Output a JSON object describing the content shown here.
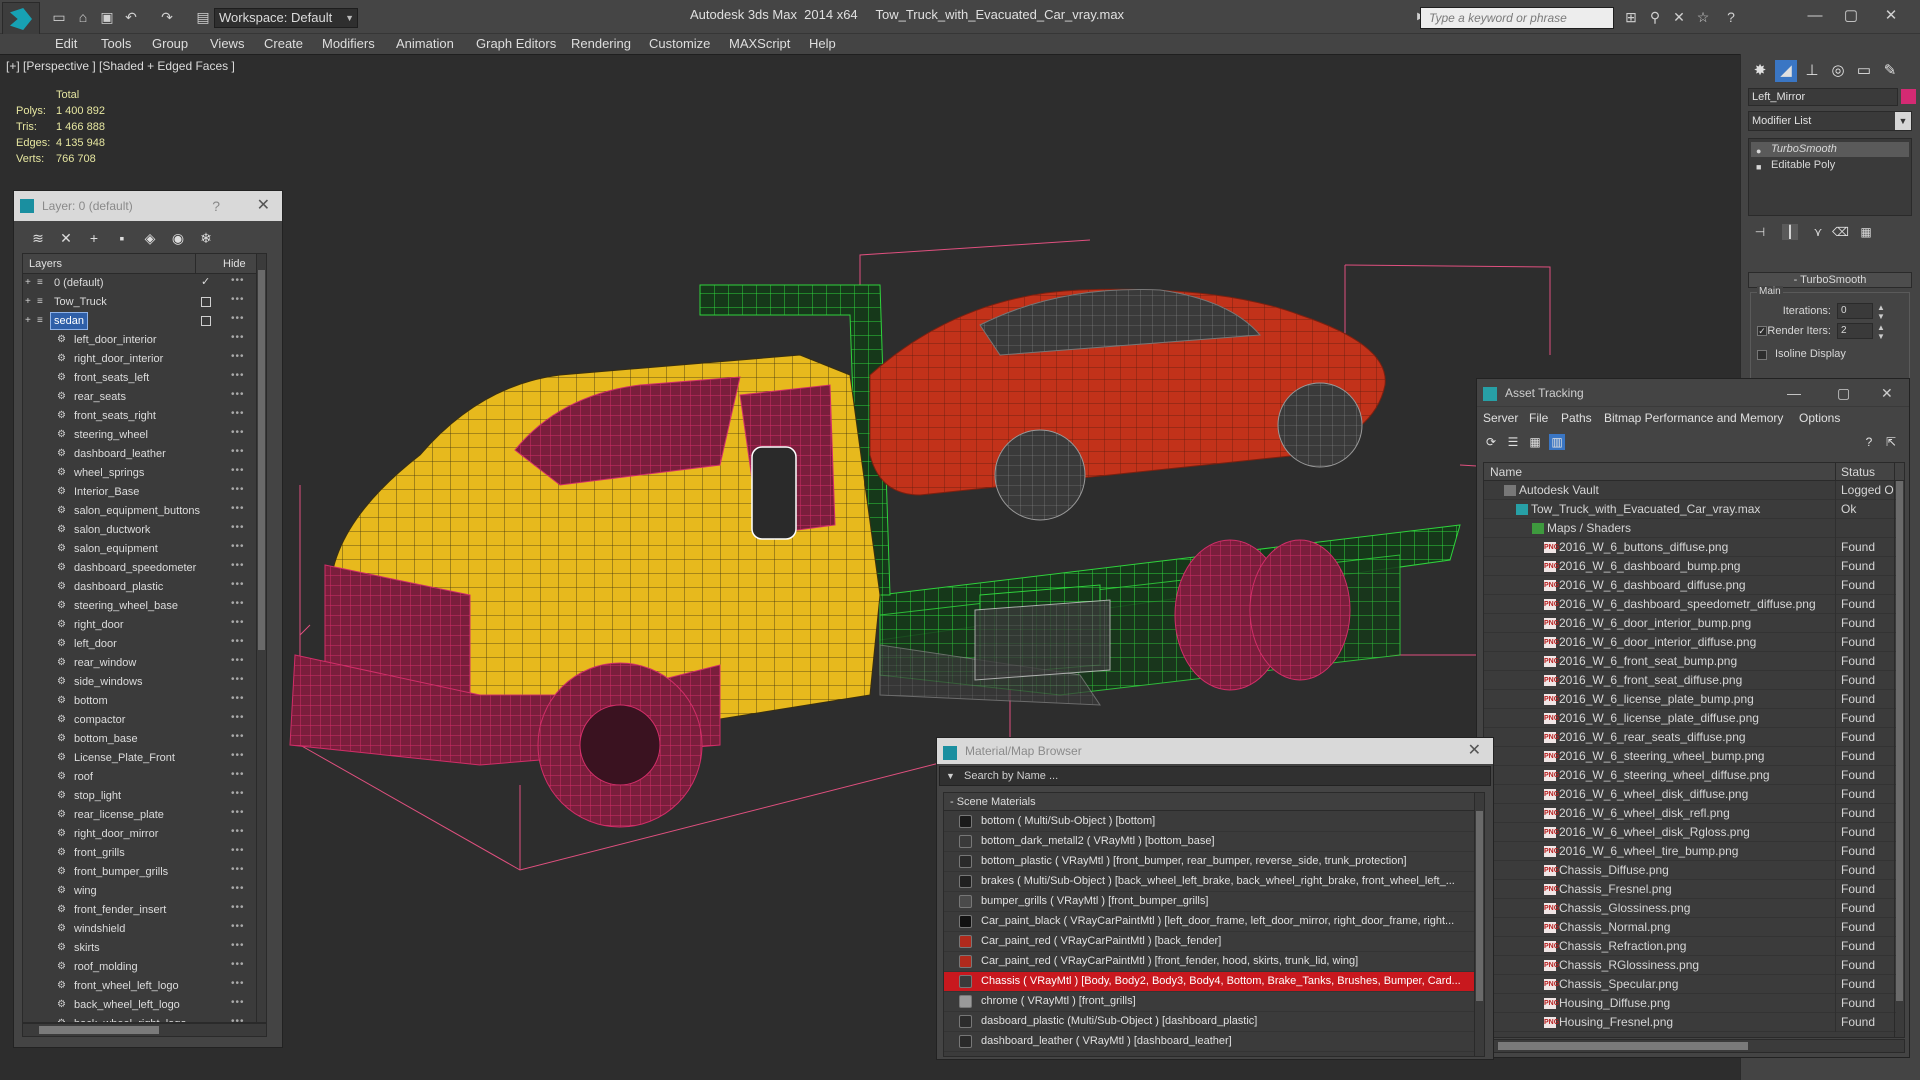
{
  "window": {
    "app_title": "Autodesk 3ds Max  2014 x64",
    "file_title": "Tow_Truck_with_Evacuated_Car_vray.max",
    "workspace": "Workspace: Default",
    "help_search_placeholder": "Type a keyword or phrase"
  },
  "menu": [
    "Edit",
    "Tools",
    "Group",
    "Views",
    "Create",
    "Modifiers",
    "Animation",
    "Graph Editors",
    "Rendering",
    "Customize",
    "MAXScript",
    "Help"
  ],
  "viewport": {
    "label": "[+] [Perspective ] [Shaded + Edged Faces ]",
    "stats": {
      "header": "Total",
      "rows": [
        {
          "key": "Polys:",
          "value": "1 400 892"
        },
        {
          "key": "Tris:",
          "value": "1 466 888"
        },
        {
          "key": "Edges:",
          "value": "4 135 948"
        },
        {
          "key": "Verts:",
          "value": "766 708"
        }
      ]
    }
  },
  "layer_panel": {
    "title": "Layer: 0 (default)",
    "help": "?",
    "close": "✕",
    "col_layers": "Layers",
    "col_hide": "Hide",
    "rows": [
      {
        "name": "0 (default)",
        "level": 0,
        "state": "check"
      },
      {
        "name": "Tow_Truck",
        "level": 0,
        "state": "box"
      },
      {
        "name": "sedan",
        "level": 0,
        "state": "box",
        "selected": true
      },
      {
        "name": "left_door_interior",
        "level": 1
      },
      {
        "name": "right_door_interior",
        "level": 1
      },
      {
        "name": "front_seats_left",
        "level": 1
      },
      {
        "name": "rear_seats",
        "level": 1
      },
      {
        "name": "front_seats_right",
        "level": 1
      },
      {
        "name": "steering_wheel",
        "level": 1
      },
      {
        "name": "dashboard_leather",
        "level": 1
      },
      {
        "name": "wheel_springs",
        "level": 1
      },
      {
        "name": "Interior_Base",
        "level": 1
      },
      {
        "name": "salon_equipment_buttons",
        "level": 1
      },
      {
        "name": "salon_ductwork",
        "level": 1
      },
      {
        "name": "salon_equipment",
        "level": 1
      },
      {
        "name": "dashboard_speedometer",
        "level": 1
      },
      {
        "name": "dashboard_plastic",
        "level": 1
      },
      {
        "name": "steering_wheel_base",
        "level": 1
      },
      {
        "name": "right_door",
        "level": 1
      },
      {
        "name": "left_door",
        "level": 1
      },
      {
        "name": "rear_window",
        "level": 1
      },
      {
        "name": "side_windows",
        "level": 1
      },
      {
        "name": "bottom",
        "level": 1
      },
      {
        "name": "compactor",
        "level": 1
      },
      {
        "name": "bottom_base",
        "level": 1
      },
      {
        "name": "License_Plate_Front",
        "level": 1
      },
      {
        "name": "roof",
        "level": 1
      },
      {
        "name": "stop_light",
        "level": 1
      },
      {
        "name": "rear_license_plate",
        "level": 1
      },
      {
        "name": "right_door_mirror",
        "level": 1
      },
      {
        "name": "front_grills",
        "level": 1
      },
      {
        "name": "front_bumper_grills",
        "level": 1
      },
      {
        "name": "wing",
        "level": 1
      },
      {
        "name": "front_fender_insert",
        "level": 1
      },
      {
        "name": "windshield",
        "level": 1
      },
      {
        "name": "skirts",
        "level": 1
      },
      {
        "name": "roof_molding",
        "level": 1
      },
      {
        "name": "front_wheel_left_logo",
        "level": 1
      },
      {
        "name": "back_wheel_left_logo",
        "level": 1
      },
      {
        "name": "back_wheel_right_logo",
        "level": 1
      }
    ]
  },
  "command_panel": {
    "object_name": "Left_Mirror",
    "modifier_list": "Modifier List",
    "stack": [
      {
        "name": "TurboSmooth",
        "active": true
      },
      {
        "name": "Editable Poly",
        "active": false
      }
    ],
    "rollout_title": "TurboSmooth",
    "group_main": "Main",
    "iterations_label": "Iterations:",
    "iterations_value": "0",
    "render_iters_label": "Render Iters:",
    "render_iters_value": "2",
    "isoline_label": "Isoline Display",
    "colors": {
      "object": "#d42a73"
    }
  },
  "asset_panel": {
    "title": "Asset Tracking",
    "menu": [
      "Server",
      "File",
      "Paths",
      "Bitmap Performance and Memory",
      "Options"
    ],
    "col_name": "Name",
    "col_status": "Status",
    "rows": [
      {
        "name": "Autodesk Vault",
        "status": "Logged O",
        "level": 0,
        "icon": "vault"
      },
      {
        "name": "Tow_Truck_with_Evacuated_Car_vray.max",
        "status": "Ok",
        "level": 1,
        "icon": "max"
      },
      {
        "name": "Maps / Shaders",
        "status": "",
        "level": 2,
        "icon": "folder"
      },
      {
        "name": "2016_W_6_buttons_diffuse.png",
        "status": "Found",
        "level": 3,
        "icon": "png"
      },
      {
        "name": "2016_W_6_dashboard_bump.png",
        "status": "Found",
        "level": 3,
        "icon": "png"
      },
      {
        "name": "2016_W_6_dashboard_diffuse.png",
        "status": "Found",
        "level": 3,
        "icon": "png"
      },
      {
        "name": "2016_W_6_dashboard_speedometr_diffuse.png",
        "status": "Found",
        "level": 3,
        "icon": "png"
      },
      {
        "name": "2016_W_6_door_interior_bump.png",
        "status": "Found",
        "level": 3,
        "icon": "png"
      },
      {
        "name": "2016_W_6_door_interior_diffuse.png",
        "status": "Found",
        "level": 3,
        "icon": "png"
      },
      {
        "name": "2016_W_6_front_seat_bump.png",
        "status": "Found",
        "level": 3,
        "icon": "png"
      },
      {
        "name": "2016_W_6_front_seat_diffuse.png",
        "status": "Found",
        "level": 3,
        "icon": "png"
      },
      {
        "name": "2016_W_6_license_plate_bump.png",
        "status": "Found",
        "level": 3,
        "icon": "png"
      },
      {
        "name": "2016_W_6_license_plate_diffuse.png",
        "status": "Found",
        "level": 3,
        "icon": "png"
      },
      {
        "name": "2016_W_6_rear_seats_diffuse.png",
        "status": "Found",
        "level": 3,
        "icon": "png"
      },
      {
        "name": "2016_W_6_steering_wheel_bump.png",
        "status": "Found",
        "level": 3,
        "icon": "png"
      },
      {
        "name": "2016_W_6_steering_wheel_diffuse.png",
        "status": "Found",
        "level": 3,
        "icon": "png"
      },
      {
        "name": "2016_W_6_wheel_disk_diffuse.png",
        "status": "Found",
        "level": 3,
        "icon": "png"
      },
      {
        "name": "2016_W_6_wheel_disk_refl.png",
        "status": "Found",
        "level": 3,
        "icon": "png"
      },
      {
        "name": "2016_W_6_wheel_disk_Rgloss.png",
        "status": "Found",
        "level": 3,
        "icon": "png"
      },
      {
        "name": "2016_W_6_wheel_tire_bump.png",
        "status": "Found",
        "level": 3,
        "icon": "png"
      },
      {
        "name": "Chassis_Diffuse.png",
        "status": "Found",
        "level": 3,
        "icon": "png"
      },
      {
        "name": "Chassis_Fresnel.png",
        "status": "Found",
        "level": 3,
        "icon": "png"
      },
      {
        "name": "Chassis_Glossiness.png",
        "status": "Found",
        "level": 3,
        "icon": "png"
      },
      {
        "name": "Chassis_Normal.png",
        "status": "Found",
        "level": 3,
        "icon": "png"
      },
      {
        "name": "Chassis_Refraction.png",
        "status": "Found",
        "level": 3,
        "icon": "png"
      },
      {
        "name": "Chassis_RGlossiness.png",
        "status": "Found",
        "level": 3,
        "icon": "png"
      },
      {
        "name": "Chassis_Specular.png",
        "status": "Found",
        "level": 3,
        "icon": "png"
      },
      {
        "name": "Housing_Diffuse.png",
        "status": "Found",
        "level": 3,
        "icon": "png"
      },
      {
        "name": "Housing_Fresnel.png",
        "status": "Found",
        "level": 3,
        "icon": "png"
      }
    ]
  },
  "material_panel": {
    "title": "Material/Map Browser",
    "search_placeholder": "Search by Name ...",
    "group": "- Scene Materials",
    "rows": [
      {
        "text": "bottom  ( Multi/Sub-Object ) [bottom]",
        "icon_color": "#1a1a1a"
      },
      {
        "text": "bottom_dark_metall2  ( VRayMtl ) [bottom_base]",
        "icon_color": "#3a3a3a"
      },
      {
        "text": "bottom_plastic  ( VRayMtl ) [front_bumper, rear_bumper, reverse_side, trunk_protection]",
        "icon_color": "#2a2a2a"
      },
      {
        "text": "brakes  ( Multi/Sub-Object ) [back_wheel_left_brake, back_wheel_right_brake, front_wheel_left_...",
        "icon_color": "#202020"
      },
      {
        "text": "bumper_grills  ( VRayMtl ) [front_bumper_grills]",
        "icon_color": "#4a4a4a"
      },
      {
        "text": "Car_paint_black  ( VRayCarPaintMtl ) [left_door_frame, left_door_mirror, right_door_frame, right...",
        "icon_color": "#111111"
      },
      {
        "text": "Car_paint_red  ( VRayCarPaintMtl ) [back_fender]",
        "icon_color": "#b02a1c"
      },
      {
        "text": "Car_paint_red  ( VRayCarPaintMtl ) [front_fender, hood, skirts, trunk_lid, wing]",
        "icon_color": "#b02a1c"
      },
      {
        "text": "Chassis  ( VRayMtl ) [Body, Body2, Body3, Body4, Bottom, Brake_Tanks, Brushes, Bumper, Card...",
        "icon_color": "#3a3a3a",
        "selected": true
      },
      {
        "text": "chrome  ( VRayMtl ) [front_grills]",
        "icon_color": "#9a9a9a"
      },
      {
        "text": "dasboard_plastic (Multi/Sub-Object ) [dashboard_plastic]",
        "icon_color": "#2c2c2c"
      },
      {
        "text": "dashboard_leather  ( VRayMtl ) [dashboard_leather]",
        "icon_color": "#2a2a2a"
      }
    ]
  }
}
